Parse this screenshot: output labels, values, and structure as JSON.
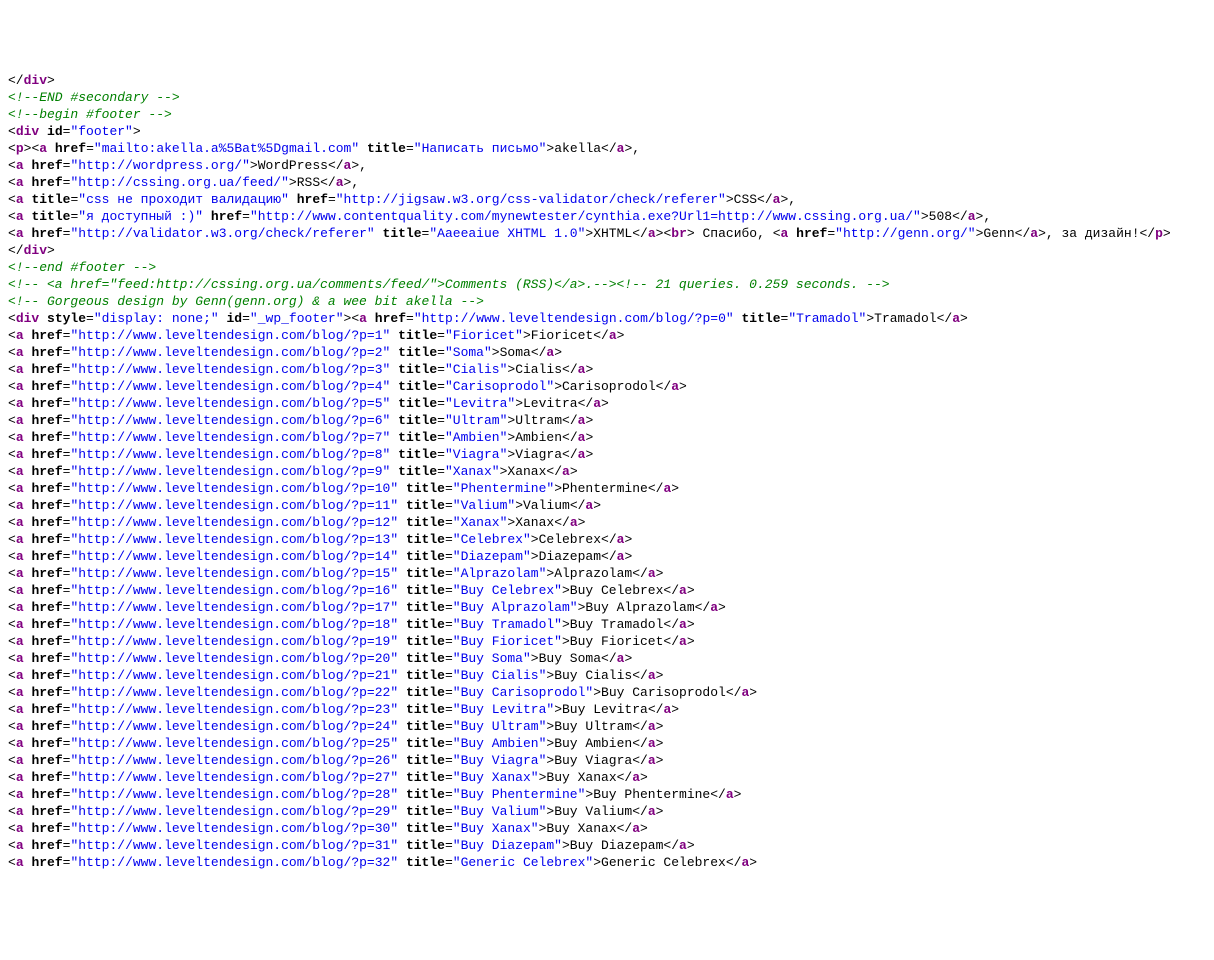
{
  "pre": [
    {
      "t": "punc",
      "v": "</"
    },
    {
      "t": "tag",
      "v": "div"
    },
    {
      "t": "punc",
      "v": ">"
    }
  ],
  "comments_top": [
    "<!--END #secondary -->",
    "",
    "<!--begin #footer -->"
  ],
  "footer_open": [
    {
      "t": "punc",
      "v": "<"
    },
    {
      "t": "tag",
      "v": "div"
    },
    {
      "t": "txt",
      "v": " "
    },
    {
      "t": "attr",
      "v": "id"
    },
    {
      "t": "punc",
      "v": "="
    },
    {
      "t": "val",
      "v": "\"footer\""
    },
    {
      "t": "punc",
      "v": ">"
    }
  ],
  "footer_lines": [
    [
      {
        "t": "punc",
        "v": "<"
      },
      {
        "t": "tag",
        "v": "p"
      },
      {
        "t": "punc",
        "v": ">"
      },
      {
        "t": "punc",
        "v": "<"
      },
      {
        "t": "tag",
        "v": "a"
      },
      {
        "t": "txt",
        "v": " "
      },
      {
        "t": "attr",
        "v": "href"
      },
      {
        "t": "punc",
        "v": "="
      },
      {
        "t": "val",
        "v": "\"mailto:akella.a%5Bat%5Dgmail.com\""
      },
      {
        "t": "txt",
        "v": " "
      },
      {
        "t": "attr",
        "v": "title"
      },
      {
        "t": "punc",
        "v": "="
      },
      {
        "t": "val",
        "v": "\"Написать письмо\""
      },
      {
        "t": "punc",
        "v": ">"
      },
      {
        "t": "txt",
        "v": "akella"
      },
      {
        "t": "punc",
        "v": "</"
      },
      {
        "t": "tag",
        "v": "a"
      },
      {
        "t": "punc",
        "v": ">"
      },
      {
        "t": "txt",
        "v": ","
      }
    ],
    [
      {
        "t": "punc",
        "v": "<"
      },
      {
        "t": "tag",
        "v": "a"
      },
      {
        "t": "txt",
        "v": " "
      },
      {
        "t": "attr",
        "v": "href"
      },
      {
        "t": "punc",
        "v": "="
      },
      {
        "t": "val",
        "v": "\"http://wordpress.org/\""
      },
      {
        "t": "punc",
        "v": ">"
      },
      {
        "t": "txt",
        "v": "WordPress"
      },
      {
        "t": "punc",
        "v": "</"
      },
      {
        "t": "tag",
        "v": "a"
      },
      {
        "t": "punc",
        "v": ">"
      },
      {
        "t": "txt",
        "v": ","
      }
    ],
    [
      {
        "t": "punc",
        "v": "<"
      },
      {
        "t": "tag",
        "v": "a"
      },
      {
        "t": "txt",
        "v": " "
      },
      {
        "t": "attr",
        "v": "href"
      },
      {
        "t": "punc",
        "v": "="
      },
      {
        "t": "val",
        "v": "\"http://cssing.org.ua/feed/\""
      },
      {
        "t": "punc",
        "v": ">"
      },
      {
        "t": "txt",
        "v": "RSS"
      },
      {
        "t": "punc",
        "v": "</"
      },
      {
        "t": "tag",
        "v": "a"
      },
      {
        "t": "punc",
        "v": ">"
      },
      {
        "t": "txt",
        "v": ","
      }
    ],
    [
      {
        "t": "punc",
        "v": "<"
      },
      {
        "t": "tag",
        "v": "a"
      },
      {
        "t": "txt",
        "v": " "
      },
      {
        "t": "attr",
        "v": "title"
      },
      {
        "t": "punc",
        "v": "="
      },
      {
        "t": "val",
        "v": "\"css не проходит валидацию\""
      },
      {
        "t": "txt",
        "v": " "
      },
      {
        "t": "attr",
        "v": "href"
      },
      {
        "t": "punc",
        "v": "="
      },
      {
        "t": "val",
        "v": "\"http://jigsaw.w3.org/css-validator/check/referer\""
      },
      {
        "t": "punc",
        "v": ">"
      },
      {
        "t": "txt",
        "v": "CSS"
      },
      {
        "t": "punc",
        "v": "</"
      },
      {
        "t": "tag",
        "v": "a"
      },
      {
        "t": "punc",
        "v": ">"
      },
      {
        "t": "txt",
        "v": ","
      }
    ],
    [
      {
        "t": "punc",
        "v": "<"
      },
      {
        "t": "tag",
        "v": "a"
      },
      {
        "t": "txt",
        "v": " "
      },
      {
        "t": "attr",
        "v": "title"
      },
      {
        "t": "punc",
        "v": "="
      },
      {
        "t": "val",
        "v": "\"я доступный :)\""
      },
      {
        "t": "txt",
        "v": " "
      },
      {
        "t": "attr",
        "v": "href"
      },
      {
        "t": "punc",
        "v": "="
      },
      {
        "t": "val",
        "v": "\"http://www.contentquality.com/mynewtester/cynthia.exe?Url1=http://www.cssing.org.ua/\""
      },
      {
        "t": "punc",
        "v": ">"
      },
      {
        "t": "txt",
        "v": "508"
      },
      {
        "t": "punc",
        "v": "</"
      },
      {
        "t": "tag",
        "v": "a"
      },
      {
        "t": "punc",
        "v": ">"
      },
      {
        "t": "txt",
        "v": ","
      }
    ],
    [
      {
        "t": "punc",
        "v": "<"
      },
      {
        "t": "tag",
        "v": "a"
      },
      {
        "t": "txt",
        "v": " "
      },
      {
        "t": "attr",
        "v": "href"
      },
      {
        "t": "punc",
        "v": "="
      },
      {
        "t": "val",
        "v": "\"http://validator.w3.org/check/referer\""
      },
      {
        "t": "txt",
        "v": " "
      },
      {
        "t": "attr",
        "v": "title"
      },
      {
        "t": "punc",
        "v": "="
      },
      {
        "t": "val",
        "v": "\"Aaeeaiue XHTML 1.0\""
      },
      {
        "t": "punc",
        "v": ">"
      },
      {
        "t": "txt",
        "v": "XHTML"
      },
      {
        "t": "punc",
        "v": "</"
      },
      {
        "t": "tag",
        "v": "a"
      },
      {
        "t": "punc",
        "v": ">"
      },
      {
        "t": "punc",
        "v": "<"
      },
      {
        "t": "tag",
        "v": "br"
      },
      {
        "t": "punc",
        "v": ">"
      },
      {
        "t": "txt",
        "v": " Спасибо, "
      },
      {
        "t": "punc",
        "v": "<"
      },
      {
        "t": "tag",
        "v": "a"
      },
      {
        "t": "txt",
        "v": " "
      },
      {
        "t": "attr",
        "v": "href"
      },
      {
        "t": "punc",
        "v": "="
      },
      {
        "t": "val",
        "v": "\"http://genn.org/\""
      },
      {
        "t": "punc",
        "v": ">"
      },
      {
        "t": "txt",
        "v": "Genn"
      },
      {
        "t": "punc",
        "v": "</"
      },
      {
        "t": "tag",
        "v": "a"
      },
      {
        "t": "punc",
        "v": ">"
      },
      {
        "t": "txt",
        "v": ", за дизайн!"
      },
      {
        "t": "punc",
        "v": "</"
      },
      {
        "t": "tag",
        "v": "p"
      },
      {
        "t": "punc",
        "v": ">"
      }
    ]
  ],
  "footer_close": [
    {
      "t": "punc",
      "v": "</"
    },
    {
      "t": "tag",
      "v": "div"
    },
    {
      "t": "punc",
      "v": ">"
    }
  ],
  "comments_mid": [
    "<!--end #footer -->",
    "<!-- <a href=\"feed:http://cssing.org.ua/comments/feed/\">Comments (RSS)</a>.--><!-- 21 queries. 0.259 seconds. -->",
    "<!-- Gorgeous design by Genn(genn.org) & a wee bit akella -->"
  ],
  "wp_div_open": [
    {
      "t": "punc",
      "v": "<"
    },
    {
      "t": "tag",
      "v": "div"
    },
    {
      "t": "txt",
      "v": " "
    },
    {
      "t": "attr",
      "v": "style"
    },
    {
      "t": "punc",
      "v": "="
    },
    {
      "t": "val",
      "v": "\"display: none;\""
    },
    {
      "t": "txt",
      "v": " "
    },
    {
      "t": "attr",
      "v": "id"
    },
    {
      "t": "punc",
      "v": "="
    },
    {
      "t": "val",
      "v": "\"_wp_footer\""
    },
    {
      "t": "punc",
      "v": ">"
    },
    {
      "t": "punc",
      "v": "<"
    },
    {
      "t": "tag",
      "v": "a"
    },
    {
      "t": "txt",
      "v": " "
    },
    {
      "t": "attr",
      "v": "href"
    },
    {
      "t": "punc",
      "v": "="
    },
    {
      "t": "val",
      "v": "\"http://www.leveltendesign.com/blog/?p=0\""
    },
    {
      "t": "txt",
      "v": " "
    },
    {
      "t": "attr",
      "v": "title"
    },
    {
      "t": "punc",
      "v": "="
    },
    {
      "t": "val",
      "v": "\"Tramadol\""
    },
    {
      "t": "punc",
      "v": ">"
    },
    {
      "t": "txt",
      "v": "Tramadol"
    },
    {
      "t": "punc",
      "v": "</"
    },
    {
      "t": "tag",
      "v": "a"
    },
    {
      "t": "punc",
      "v": ">"
    }
  ],
  "links": [
    {
      "p": 1,
      "title": "Fioricet",
      "text": "Fioricet"
    },
    {
      "p": 2,
      "title": "Soma",
      "text": "Soma"
    },
    {
      "p": 3,
      "title": "Cialis",
      "text": "Cialis"
    },
    {
      "p": 4,
      "title": "Carisoprodol",
      "text": "Carisoprodol"
    },
    {
      "p": 5,
      "title": "Levitra",
      "text": "Levitra"
    },
    {
      "p": 6,
      "title": "Ultram",
      "text": "Ultram"
    },
    {
      "p": 7,
      "title": "Ambien",
      "text": "Ambien"
    },
    {
      "p": 8,
      "title": "Viagra",
      "text": "Viagra"
    },
    {
      "p": 9,
      "title": "Xanax",
      "text": "Xanax"
    },
    {
      "p": 10,
      "title": "Phentermine",
      "text": "Phentermine"
    },
    {
      "p": 11,
      "title": "Valium",
      "text": "Valium"
    },
    {
      "p": 12,
      "title": "Xanax",
      "text": "Xanax"
    },
    {
      "p": 13,
      "title": "Celebrex",
      "text": "Celebrex"
    },
    {
      "p": 14,
      "title": "Diazepam",
      "text": "Diazepam"
    },
    {
      "p": 15,
      "title": "Alprazolam",
      "text": "Alprazolam"
    },
    {
      "p": 16,
      "title": "Buy Celebrex",
      "text": "Buy Celebrex"
    },
    {
      "p": 17,
      "title": "Buy Alprazolam",
      "text": "Buy Alprazolam"
    },
    {
      "p": 18,
      "title": "Buy Tramadol",
      "text": "Buy Tramadol"
    },
    {
      "p": 19,
      "title": "Buy Fioricet",
      "text": "Buy Fioricet"
    },
    {
      "p": 20,
      "title": "Buy Soma",
      "text": "Buy Soma"
    },
    {
      "p": 21,
      "title": "Buy Cialis",
      "text": "Buy Cialis"
    },
    {
      "p": 22,
      "title": "Buy Carisoprodol",
      "text": "Buy Carisoprodol"
    },
    {
      "p": 23,
      "title": "Buy Levitra",
      "text": "Buy Levitra"
    },
    {
      "p": 24,
      "title": "Buy Ultram",
      "text": "Buy Ultram"
    },
    {
      "p": 25,
      "title": "Buy Ambien",
      "text": "Buy Ambien"
    },
    {
      "p": 26,
      "title": "Buy Viagra",
      "text": "Buy Viagra"
    },
    {
      "p": 27,
      "title": "Buy Xanax",
      "text": "Buy Xanax"
    },
    {
      "p": 28,
      "title": "Buy Phentermine",
      "text": "Buy Phentermine"
    },
    {
      "p": 29,
      "title": "Buy Valium",
      "text": "Buy Valium"
    },
    {
      "p": 30,
      "title": "Buy Xanax",
      "text": "Buy Xanax"
    },
    {
      "p": 31,
      "title": "Buy Diazepam",
      "text": "Buy Diazepam"
    },
    {
      "p": 32,
      "title": "Generic Celebrex",
      "text": "Generic Celebrex"
    }
  ],
  "link_href_prefix": "http://www.leveltendesign.com/blog/?p="
}
